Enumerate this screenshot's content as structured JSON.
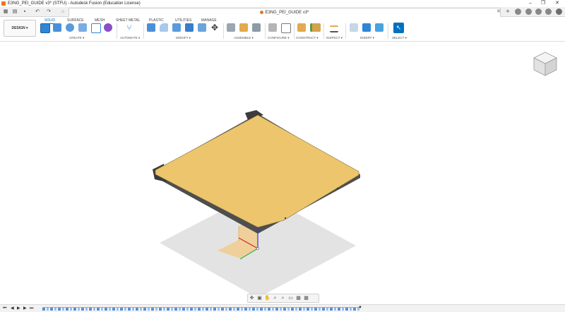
{
  "window": {
    "title": "E3NG_PEI_GUIDE v3* (STFU) - Autodesk Fusion (Education License)",
    "controls": [
      "–",
      "❐",
      "✕"
    ]
  },
  "quick_access": {
    "grid_icon": "grid-icon",
    "file_icon": "file-icon",
    "save_icon": "save-icon",
    "undo_icon": "undo-icon",
    "redo_icon": "redo-icon",
    "home_icon": "home-icon"
  },
  "document_tab": {
    "name": "E3NG_PEI_GUIDE v3*",
    "close": "✕"
  },
  "ribbon": {
    "workspace_label": "DESIGN ▾",
    "tabs": [
      {
        "label": "SOLID",
        "active": true
      },
      {
        "label": "SURFACE"
      },
      {
        "label": "MESH"
      },
      {
        "label": "SHEET METAL"
      },
      {
        "label": "PLASTIC"
      },
      {
        "label": "UTILITIES"
      },
      {
        "label": "MANAGE"
      }
    ],
    "groups": [
      {
        "label": "CREATE ▾"
      },
      {
        "label": "AUTOMATE ▾"
      },
      {
        "label": "MODIFY ▾"
      },
      {
        "label": "ASSEMBLE ▾"
      },
      {
        "label": "CONFIGURE ▾"
      },
      {
        "label": "CONSTRUCT ▾"
      },
      {
        "label": "INSPECT ▾"
      },
      {
        "label": "INSERT ▾"
      },
      {
        "label": "SELECT ▾"
      }
    ]
  },
  "colors": {
    "accent": "#0070c0",
    "plate_top": "#ecc56d",
    "plate_edge": "#5a5a5a",
    "shadow": "#e3e3e3",
    "sketch_plane": "#f3c882"
  },
  "navbar": {
    "items": [
      "✥",
      "▣",
      "✋",
      "⌕",
      "⌕",
      "▭",
      "▦",
      "▦"
    ]
  },
  "timeline": {
    "controls": [
      "⏮",
      "◀",
      "▶",
      "▶",
      "⏭"
    ]
  }
}
